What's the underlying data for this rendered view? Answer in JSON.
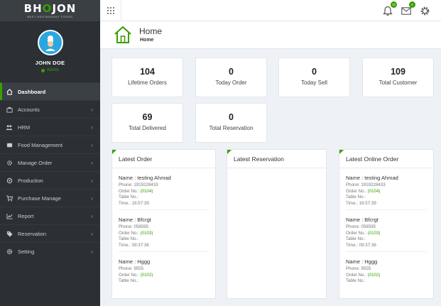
{
  "brand": {
    "name_pre": "BH",
    "name_o": "O",
    "name_post": "JON",
    "tagline": "BEST RESTAURANT FOODS"
  },
  "user": {
    "name": "JOHN DOE",
    "role": "Admin"
  },
  "menu": [
    {
      "label": "Dashboard",
      "icon": "home-icon",
      "active": true
    },
    {
      "label": "Accounts",
      "icon": "briefcase-icon"
    },
    {
      "label": "HRM",
      "icon": "users-icon"
    },
    {
      "label": "Food Management",
      "icon": "food-icon"
    },
    {
      "label": "Manage Order",
      "icon": "cog-icon"
    },
    {
      "label": "Production",
      "icon": "production-icon"
    },
    {
      "label": "Purchase Manage",
      "icon": "cart-icon"
    },
    {
      "label": "Report",
      "icon": "chart-icon"
    },
    {
      "label": "Reservation",
      "icon": "tag-icon"
    },
    {
      "label": "Setting",
      "icon": "gear-icon"
    }
  ],
  "topbar": {
    "notif_count": "10",
    "mail_count": "0"
  },
  "page": {
    "title": "Home",
    "breadcrumb": "Home"
  },
  "stats": [
    {
      "value": "104",
      "label": "Lifetime Orders"
    },
    {
      "value": "0",
      "label": "Today Order"
    },
    {
      "value": "0",
      "label": "Today Sell"
    },
    {
      "value": "109",
      "label": "Total Customer"
    },
    {
      "value": "69",
      "label": "Total Delivered"
    },
    {
      "value": "0",
      "label": "Total Reservation"
    }
  ],
  "panels": {
    "latest_order": {
      "title": "Latest Order",
      "orders": [
        {
          "name": "Name : testing Ahmad",
          "phone": "Phone: 1919228433",
          "order_label": "Order No.: ",
          "order_no": "(0104)",
          "table": "Table No.:",
          "time": "Time.: 16:57:39"
        },
        {
          "name": "Name : Bfcrgt",
          "phone": "Phone: 058595",
          "order_label": "Order No.: ",
          "order_no": "(0103)",
          "table": "Table No.:",
          "time": "Time.: 09:37:36"
        },
        {
          "name": "Name : Hggg",
          "phone": "Phone: 9555",
          "order_label": "Order No.: ",
          "order_no": "(0102)",
          "table": "Table No.:",
          "time": ""
        }
      ]
    },
    "latest_reservation": {
      "title": "Latest Reservation"
    },
    "latest_online_order": {
      "title": "Latest Online Order",
      "orders": [
        {
          "name": "Name : testing Ahmad",
          "phone": "Phone: 1919228433",
          "order_label": "Order No.: ",
          "order_no": "(0104)",
          "table": "Table No.:",
          "time": "Time.: 16:57:39"
        },
        {
          "name": "Name : Bfcrgt",
          "phone": "Phone: 058595",
          "order_label": "Order No.: ",
          "order_no": "(0103)",
          "table": "Table No.:",
          "time": "Time.: 09:37:36"
        },
        {
          "name": "Name : Hggg",
          "phone": "Phone: 9555",
          "order_label": "Order No.: ",
          "order_no": "(0102)",
          "table": "Table No.:",
          "time": ""
        }
      ]
    }
  },
  "colors": {
    "accent": "#37a000",
    "sidebar": "#2c3034",
    "avatar": "#29a8e0"
  }
}
